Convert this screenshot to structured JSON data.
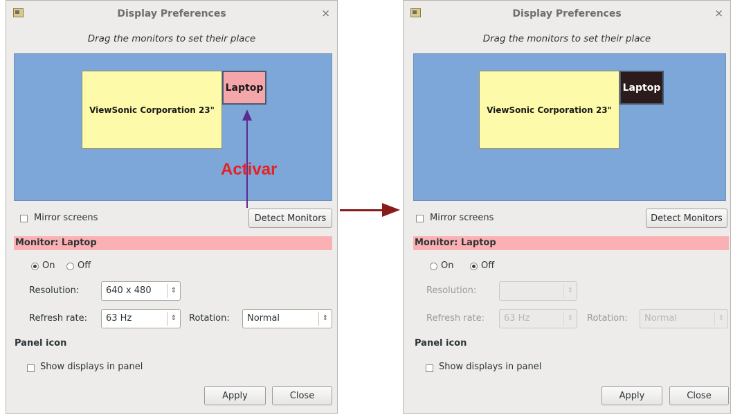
{
  "left": {
    "title": "Display Preferences",
    "close_glyph": "×",
    "hint": "Drag the monitors to set their place",
    "monitor_big": "ViewSonic Corporation 23\"",
    "monitor_small": "Laptop",
    "annotation": "Activar",
    "mirror_label": "Mirror screens",
    "detect_label": "Detect Monitors",
    "section_label": "Monitor: Laptop",
    "on_label": "On",
    "off_label": "Off",
    "on_selected": true,
    "resolution_label": "Resolution:",
    "resolution_value": "640 x 480",
    "refresh_label": "Refresh rate:",
    "refresh_value": "63 Hz",
    "rotation_label": "Rotation:",
    "rotation_value": "Normal",
    "panel_icon_heading": "Panel icon",
    "show_displays_label": "Show displays in panel",
    "apply_label": "Apply",
    "close_label": "Close"
  },
  "right": {
    "title": "Display Preferences",
    "close_glyph": "×",
    "hint": "Drag the monitors to set their place",
    "monitor_big": "ViewSonic Corporation 23\"",
    "monitor_small": "Laptop",
    "mirror_label": "Mirror screens",
    "detect_label": "Detect Monitors",
    "section_label": "Monitor: Laptop",
    "on_label": "On",
    "off_label": "Off",
    "on_selected": false,
    "resolution_label": "Resolution:",
    "resolution_value": "",
    "refresh_label": "Refresh rate:",
    "refresh_value": "63 Hz",
    "rotation_label": "Rotation:",
    "rotation_value": "Normal",
    "panel_icon_heading": "Panel icon",
    "show_displays_label": "Show displays in panel",
    "apply_label": "Apply",
    "close_label": "Close"
  },
  "colors": {
    "arrangement_bg": "#7ea7d9",
    "monitor_big_fill": "#fdfba9",
    "laptop_active_fill": "#f4a6ab",
    "laptop_off_fill": "#2b1b1b",
    "section_bar": "#fbb1b4",
    "annotation_text": "#e32222",
    "annotation_arrow": "#5b2b8f",
    "transition_arrow": "#8a1a1a"
  }
}
